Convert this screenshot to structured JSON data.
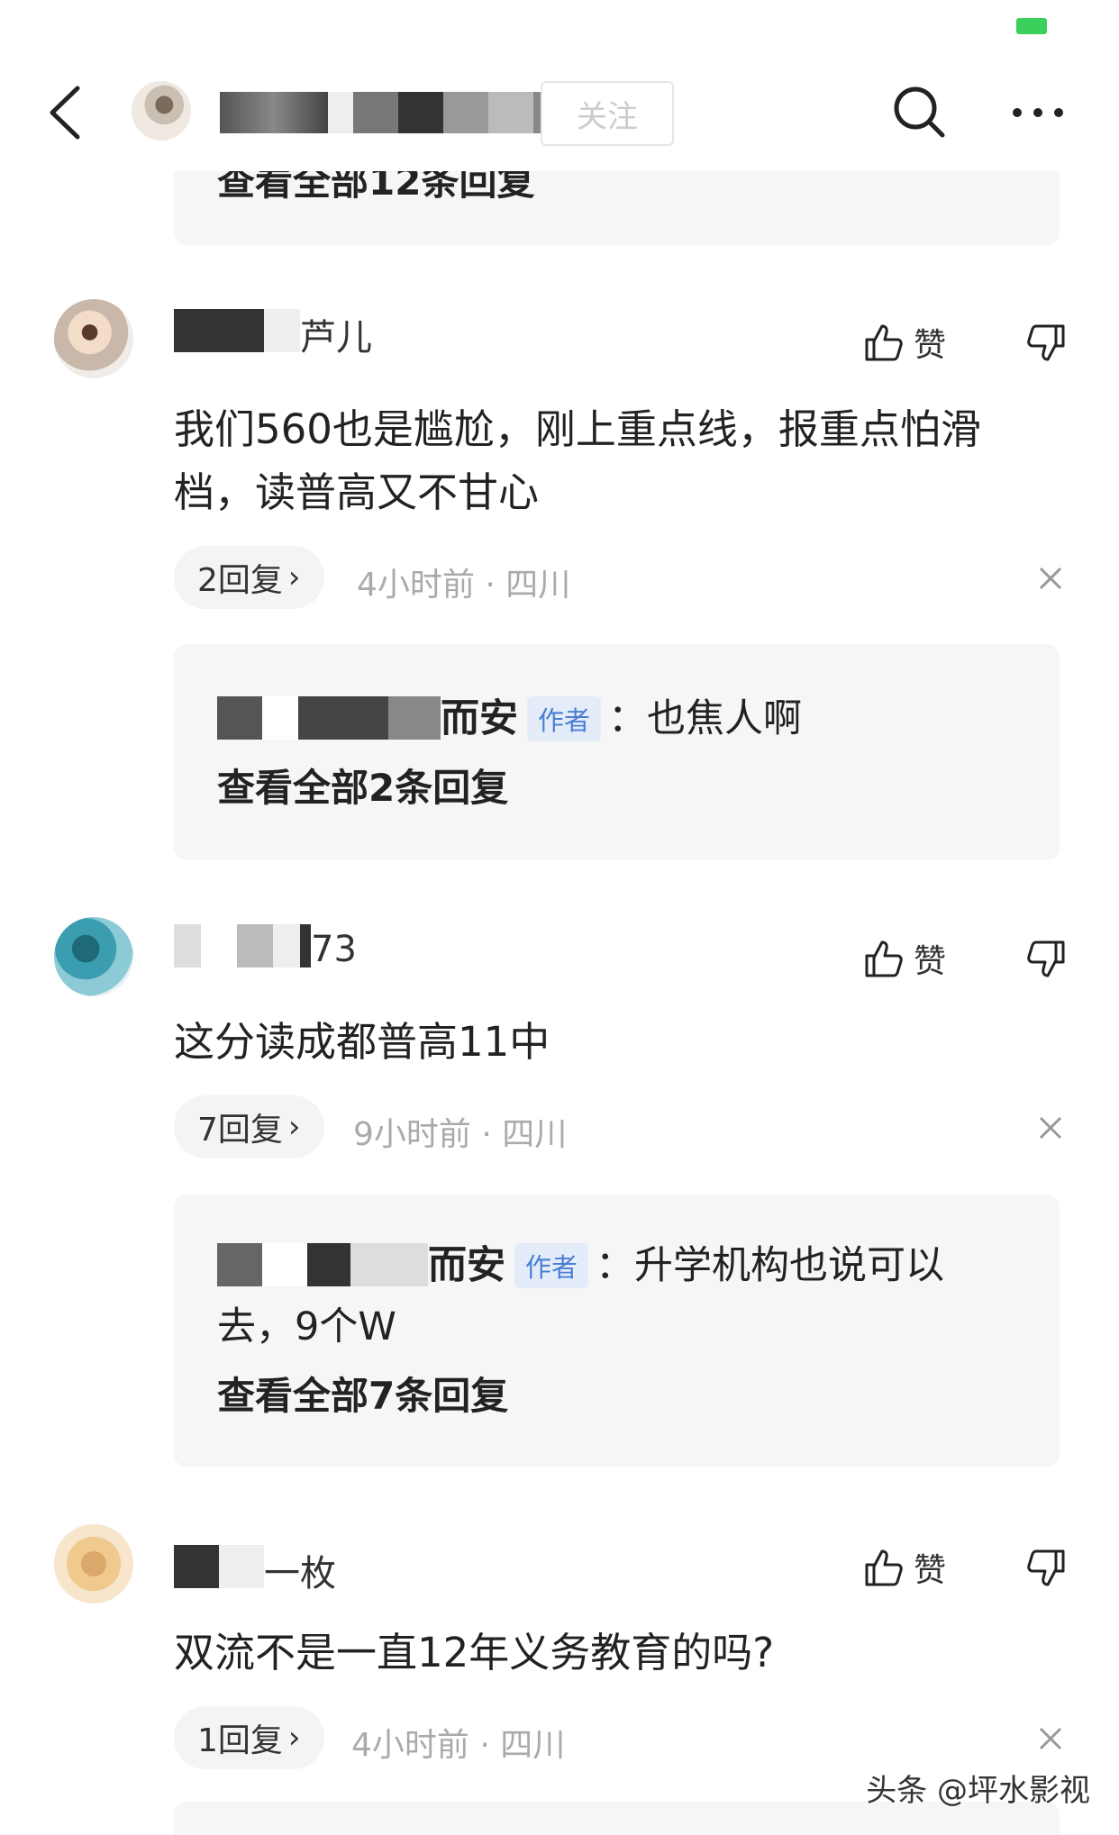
{
  "header": {
    "follow_label": "关注",
    "partial_reply_text": "查看全部12条回复"
  },
  "comments": [
    {
      "username_suffix": "芦儿",
      "like_label": "赞",
      "text": "我们560也是尴尬，刚上重点线，报重点怕滑档，读普高又不甘心",
      "reply_count_label": "2回复",
      "time": "4小时前",
      "location": "四川",
      "reply_preview": {
        "author_suffix": "而安",
        "author_tag": "作者",
        "text": "：也焦人啊",
        "view_all": "查看全部2条回复"
      }
    },
    {
      "username_suffix": "73",
      "like_label": "赞",
      "text": "这分读成都普高11中",
      "reply_count_label": "7回复",
      "time": "9小时前",
      "location": "四川",
      "reply_preview": {
        "author_suffix": "而安",
        "author_tag": "作者",
        "text": "：升学机构也说可以",
        "text_line2": "去，9个W",
        "view_all": "查看全部7条回复"
      }
    },
    {
      "username_suffix": "一枚",
      "like_label": "赞",
      "text": "双流不是一直12年义务教育的吗?",
      "reply_count_label": "1回复",
      "time": "4小时前",
      "location": "四川"
    }
  ],
  "meta_separator": "·",
  "watermark": "头条 @坪水影视",
  "colors": {
    "battery": "#3bcf5b",
    "author_tag_text": "#4a7fd4",
    "author_tag_bg": "#e4ecfa",
    "meta_text": "#aaaaaa",
    "reply_box_bg": "#f6f6f6"
  }
}
